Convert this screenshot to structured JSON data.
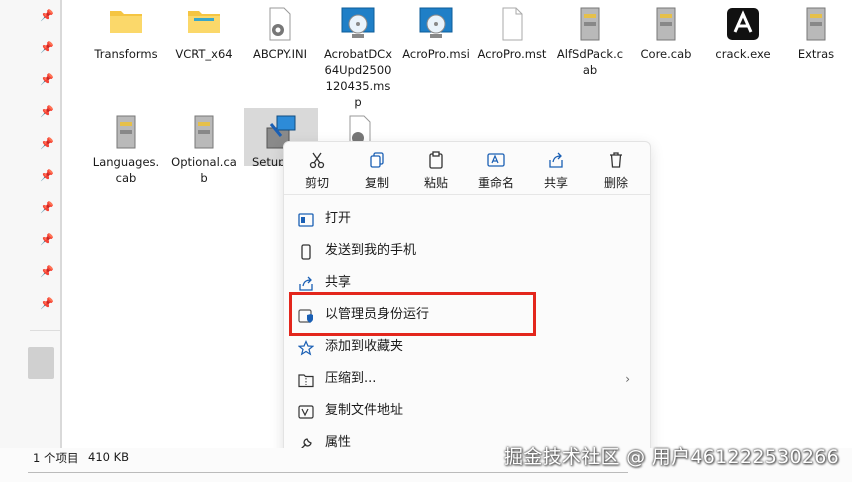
{
  "files_row1": [
    {
      "name": "Transforms",
      "icon": "folder-icon"
    },
    {
      "name": "VCRT_x64",
      "icon": "folder-icon"
    },
    {
      "name": "ABCPY.INI",
      "icon": "settings-file-icon"
    },
    {
      "name": "AcrobatDCx64Upd2500120435.msp",
      "icon": "installer-disc-icon"
    },
    {
      "name": "AcroPro.msi",
      "icon": "installer-disc-icon"
    },
    {
      "name": "AcroPro.mst",
      "icon": "blank-file-icon"
    },
    {
      "name": "AlfSdPack.cab",
      "icon": "cabinet-file-icon"
    },
    {
      "name": "Core.cab",
      "icon": "cabinet-file-icon"
    },
    {
      "name": "crack.exe",
      "icon": "acrobat-app-icon"
    },
    {
      "name": "Extras",
      "icon": "cabinet-file-icon"
    }
  ],
  "files_row2": [
    {
      "name": "Languages.cab",
      "icon": "cabinet-file-icon"
    },
    {
      "name": "Optional.cab",
      "icon": "cabinet-file-icon"
    },
    {
      "name": "Setup",
      "icon": "setup-installer-icon"
    }
  ],
  "quick_actions": [
    {
      "label": "剪切",
      "icon": "scissors-icon"
    },
    {
      "label": "复制",
      "icon": "copy-icon"
    },
    {
      "label": "粘贴",
      "icon": "paste-icon"
    },
    {
      "label": "重命名",
      "icon": "rename-icon"
    },
    {
      "label": "共享",
      "icon": "share-icon"
    },
    {
      "label": "删除",
      "icon": "trash-icon"
    }
  ],
  "menu_items": [
    {
      "label": "打开",
      "icon": "open-window-icon",
      "has_submenu": false
    },
    {
      "label": "发送到我的手机",
      "icon": "phone-icon",
      "has_submenu": false
    },
    {
      "label": "共享",
      "icon": "share-icon",
      "has_submenu": false
    },
    {
      "label": "以管理员身份运行",
      "icon": "admin-shield-icon",
      "has_submenu": false
    },
    {
      "label": "添加到收藏夹",
      "icon": "star-icon",
      "has_submenu": false
    },
    {
      "label": "压缩到...",
      "icon": "zip-folder-icon",
      "has_submenu": true
    },
    {
      "label": "复制文件地址",
      "icon": "copy-path-icon",
      "has_submenu": false
    },
    {
      "label": "属性",
      "icon": "wrench-icon",
      "has_submenu": false
    }
  ],
  "status": {
    "count": "1 个项目",
    "size": "410 KB"
  },
  "watermark": "掘金技术社区 @ 用户461222530266",
  "colors": {
    "highlight": "#e3261c",
    "accent": "#1a5fb4",
    "folder": "#f5c542"
  }
}
